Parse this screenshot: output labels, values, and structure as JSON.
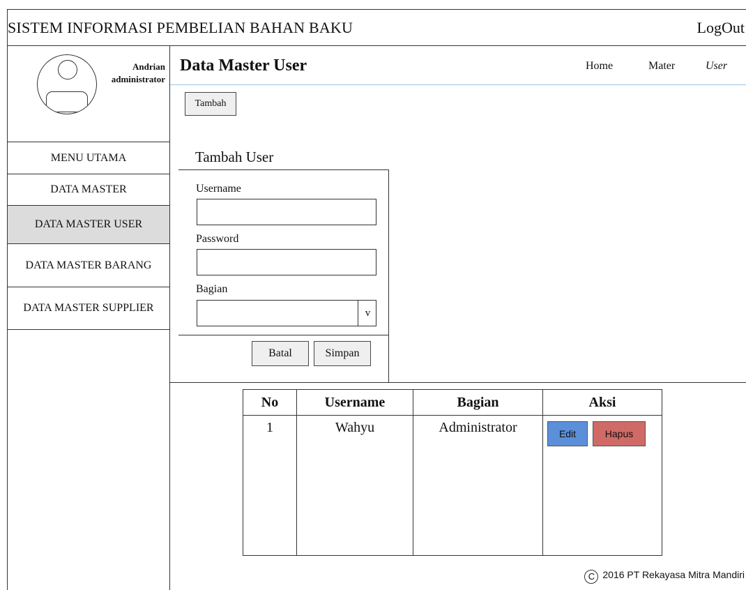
{
  "app": {
    "title": "SISTEM INFORMASI PEMBELIAN BAHAN BAKU",
    "logout_label": "LogOut"
  },
  "profile": {
    "name": "Andrian",
    "role": "administrator",
    "avatar_icon": "user-avatar-icon"
  },
  "sidebar": {
    "items": [
      {
        "label": "MENU UTAMA"
      },
      {
        "label": "DATA MASTER"
      },
      {
        "label": "DATA MASTER USER"
      },
      {
        "label": "DATA MASTER BARANG"
      },
      {
        "label": "DATA MASTER SUPPLIER"
      }
    ],
    "active_label": "DATA MASTER USER",
    "active_color": "#dcdcdc"
  },
  "header": {
    "title": "Data Master User",
    "breadcrumb": [
      "Home",
      "Mater",
      "User"
    ],
    "line_color": "#9cc3e0"
  },
  "toolbar": {
    "add_label": "Tambah"
  },
  "form": {
    "title": "Tambah User",
    "username_label": "Username",
    "username_value": "",
    "password_label": "Password",
    "password_value": "",
    "bagian_label": "Bagian",
    "bagian_value": "",
    "dropdown_indicator": "v",
    "cancel_label": "Batal",
    "save_label": "Simpan"
  },
  "table": {
    "columns": [
      "No",
      "Username",
      "Bagian",
      "Aksi"
    ],
    "rows": [
      {
        "no": "1",
        "username": "Wahyu",
        "bagian": "Administrator",
        "edit_label": "Edit",
        "delete_label": "Hapus"
      }
    ],
    "edit_color": "#5b8fd9",
    "delete_color": "#d06a67"
  },
  "footer": {
    "copyright_symbol": "C",
    "text": "2016 PT Rekayasa Mitra Mandiri"
  }
}
